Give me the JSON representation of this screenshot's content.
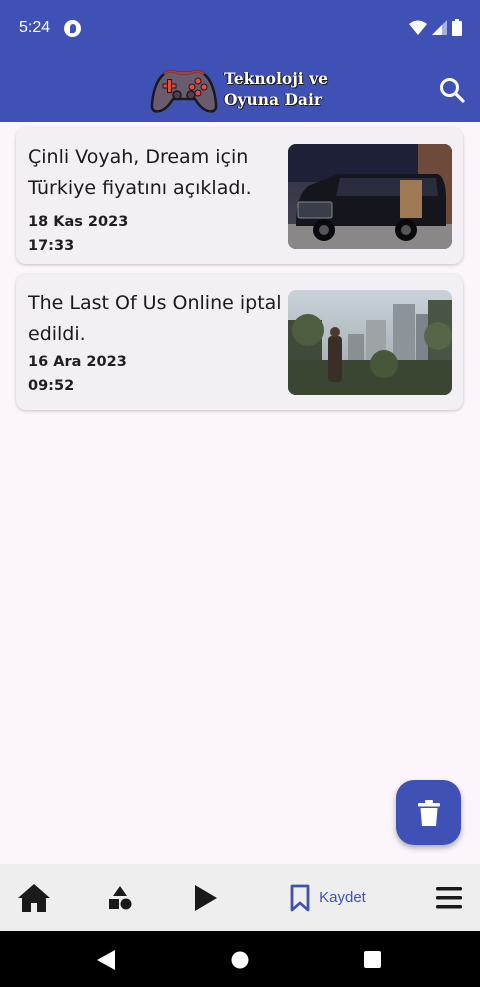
{
  "status_bar": {
    "time": "5:24",
    "icons": [
      "app-notification-icon",
      "wifi-icon",
      "signal-icon",
      "battery-icon"
    ]
  },
  "app_bar": {
    "logo_line1": "Teknoloji ve",
    "logo_line2": "Oyuna Dair",
    "search_icon": "search-icon"
  },
  "articles": [
    {
      "title": "Çinli Voyah, Dream için Türkiye fiyatını açıkladı.",
      "date": "18 Kas 2023",
      "time": "17:33",
      "thumbnail": "car-photo"
    },
    {
      "title": "The Last Of Us Online iptal edildi.",
      "date": "16 Ara 2023",
      "time": "09:52",
      "thumbnail": "game-screenshot"
    }
  ],
  "fab": {
    "icon": "trash-icon"
  },
  "bottom_nav": {
    "items": [
      {
        "icon": "home-icon"
      },
      {
        "icon": "shapes-icon"
      },
      {
        "icon": "play-icon"
      },
      {
        "icon": "bookmark-icon",
        "label": "Kaydet",
        "active": true
      },
      {
        "icon": "menu-icon"
      }
    ]
  },
  "system_nav": {
    "icons": [
      "back-icon",
      "home-circle-icon",
      "recents-icon"
    ]
  },
  "colors": {
    "primary": "#3f51b5",
    "background": "#fcf5fb",
    "card": "#f2eff5",
    "nav": "#eeeeee"
  }
}
